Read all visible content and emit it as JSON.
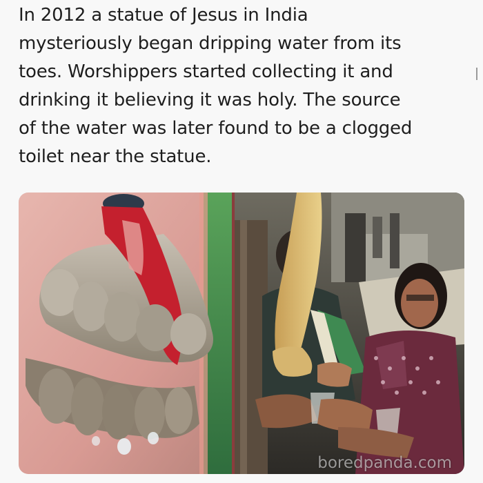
{
  "post": {
    "text": "In 2012 a statue of Jesus in India\nmysteriously began dripping water from its\ntoes. Worshippers started collecting it and\ndrinking it believing it was holy. The source\nof the water was later found to be a clogged\ntoilet near the statue."
  },
  "media": {
    "left_image": "statue-feet-photo",
    "right_image": "worshippers-collecting-water-photo",
    "watermark": "boredpanda.com"
  },
  "colors": {
    "text": "#1e1e1e",
    "background": "#f8f8f8"
  }
}
